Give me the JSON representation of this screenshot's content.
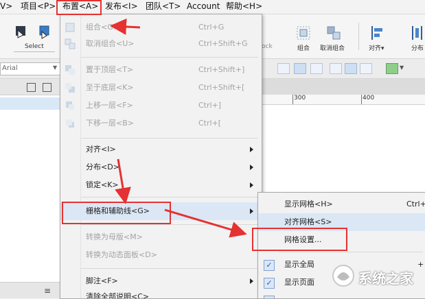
{
  "menubar": {
    "items": [
      "V>",
      "项目<P>",
      "布置<A>",
      "发布<I>",
      "团队<T>",
      "Account",
      "帮助<H>"
    ]
  },
  "toolbar": {
    "select_label": "Select",
    "ock_label": "ock",
    "group_label": "组合",
    "ungroup_label": "取消组合",
    "align_label": "对齐▾",
    "distribute_label": "分布"
  },
  "formatbar": {
    "font_value": "Arial"
  },
  "ruler": {
    "ticks": [
      "300",
      "400"
    ]
  },
  "arrange_menu": {
    "items": [
      {
        "label": "组合<G>",
        "shortcut": "Ctrl+G",
        "disabled": true
      },
      {
        "label": "取消组合<U>",
        "shortcut": "Ctrl+Shift+G",
        "disabled": true
      },
      {
        "label": "置于顶层<T>",
        "shortcut": "Ctrl+Shift+]",
        "disabled": true
      },
      {
        "label": "至于底层<K>",
        "shortcut": "Ctrl+Shift+[",
        "disabled": true
      },
      {
        "label": "上移一层<F>",
        "shortcut": "Ctrl+]",
        "disabled": true
      },
      {
        "label": "下移一层<B>",
        "shortcut": "Ctrl+[",
        "disabled": true
      },
      {
        "label": "对齐<I>",
        "shortcut": "",
        "disabled": false,
        "submenu": true
      },
      {
        "label": "分布<D>",
        "shortcut": "",
        "disabled": false,
        "submenu": true
      },
      {
        "label": "锁定<K>",
        "shortcut": "",
        "disabled": false,
        "submenu": true
      },
      {
        "label": "栅格和辅助线<G>",
        "shortcut": "",
        "disabled": false,
        "submenu": true,
        "highlighted": true
      },
      {
        "label": "转换为母版<M>",
        "shortcut": "",
        "disabled": true
      },
      {
        "label": "转换为动态面板<D>",
        "shortcut": "",
        "disabled": true
      },
      {
        "label": "脚注<F>",
        "shortcut": "",
        "disabled": false,
        "submenu": true
      },
      {
        "label": "清除全部说明<C>",
        "shortcut": "",
        "disabled": false
      }
    ]
  },
  "grid_submenu": {
    "items": [
      {
        "label": "显示网格<H>",
        "shortcut": "Ctrl+'",
        "checked": false
      },
      {
        "label": "对齐网格<S>",
        "shortcut": "",
        "checked": false,
        "highlighted": true
      },
      {
        "label": "网格设置...",
        "shortcut": "",
        "checked": false
      },
      {
        "label": "显示全局",
        "shortcut": "+",
        "checked": true
      },
      {
        "label": "显示页面",
        "shortcut": "",
        "checked": true
      },
      {
        "label": "",
        "shortcut": "",
        "checked": true
      }
    ]
  },
  "watermark": {
    "text": "系统之家"
  },
  "colors": {
    "annotation_red": "#e53131",
    "highlight": "#dbe7f5"
  }
}
